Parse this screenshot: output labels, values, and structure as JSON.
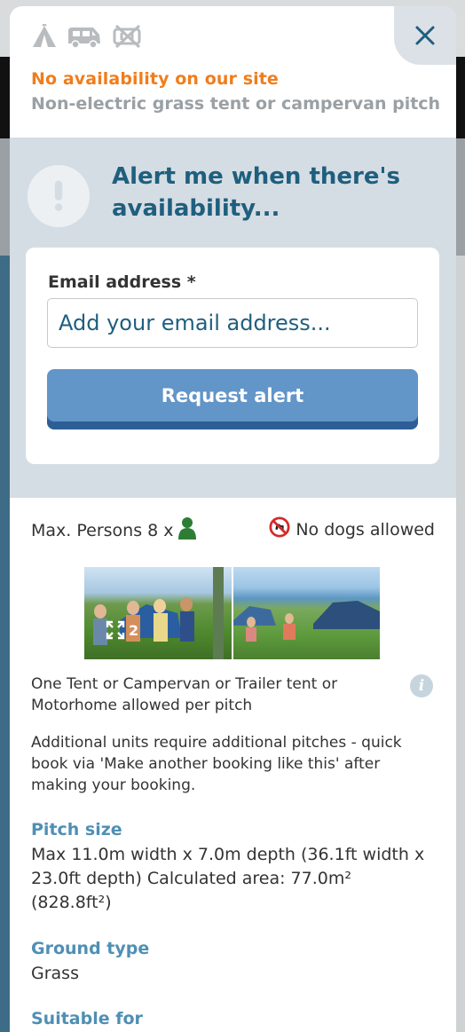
{
  "modal": {
    "close_icon": "close-icon",
    "unit_icons": [
      "tent-icon",
      "campervan-icon",
      "no-electric-icon"
    ],
    "status": "No availability on our site",
    "pitch_name": "Non-electric grass tent or campervan pitch"
  },
  "alert": {
    "title": "Alert me when there's availability...",
    "email_label": "Email address *",
    "email_placeholder": "Add your email address...",
    "email_value": "",
    "button_label": "Request alert"
  },
  "details": {
    "max_persons": "Max. Persons 8 x",
    "dogs": "No dogs allowed",
    "photo_count": "2",
    "tent_note": "One Tent or Campervan or Trailer tent or Motorhome allowed per pitch",
    "units_note": "Additional units require additional pitches - quick book via 'Make another booking like this' after making your booking.",
    "pitch_size_heading": "Pitch size",
    "pitch_size_text": "Max 11.0m width x 7.0m depth (36.1ft width x 23.0ft depth) Calculated area: 77.0m² (828.8ft²)",
    "ground_heading": "Ground type",
    "ground_text": "Grass",
    "suitable_heading": "Suitable for"
  },
  "colors": {
    "status_orange": "#f07d1c",
    "heading_blue": "#1f5f7e",
    "button_blue": "#6295c8",
    "section_blue": "#4f8fb4"
  }
}
